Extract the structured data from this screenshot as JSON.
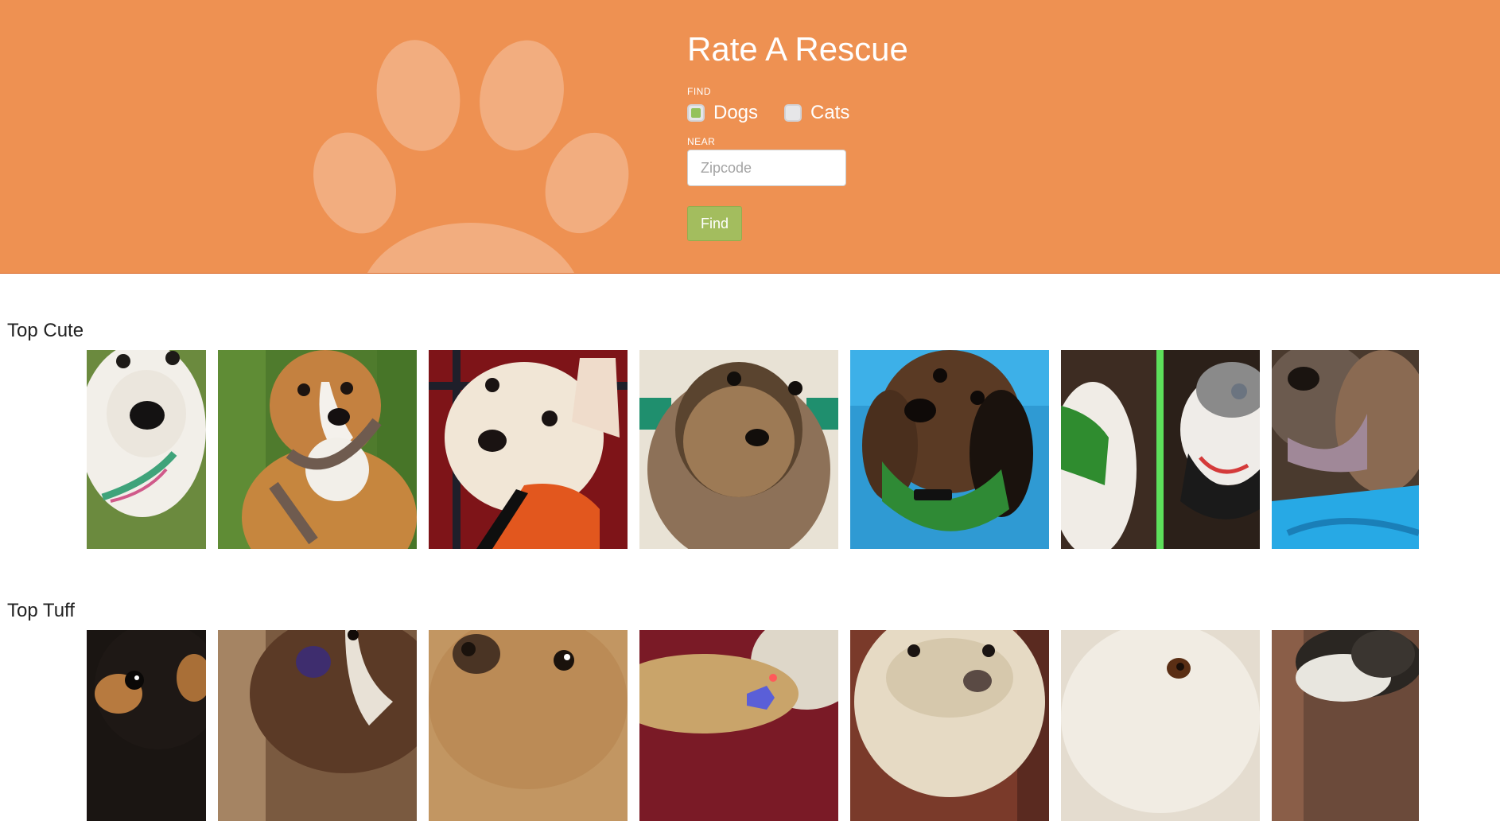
{
  "header": {
    "title": "Rate A Rescue",
    "find_label": "FIND",
    "options": [
      {
        "label": "Dogs",
        "checked": true
      },
      {
        "label": "Cats",
        "checked": false
      }
    ],
    "near_label": "NEAR",
    "zip_placeholder": "Zipcode",
    "zip_value": "",
    "find_button": "Find"
  },
  "colors": {
    "header_bg": "#ee9152",
    "paw": "#f2ad7f",
    "button": "#a3bd5e",
    "checkbox_checked": "#94c25b"
  },
  "sections": [
    {
      "title": "Top Cute",
      "count": 7
    },
    {
      "title": "Top Tuff",
      "count": 7
    }
  ]
}
